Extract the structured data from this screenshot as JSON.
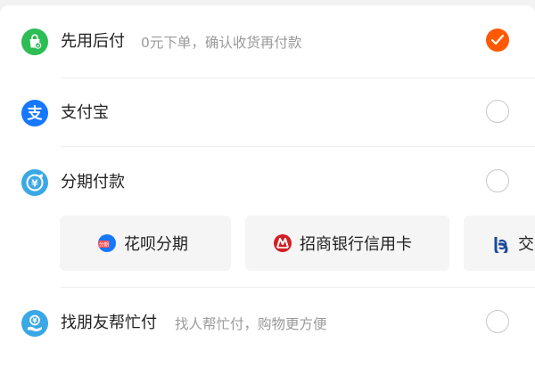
{
  "payment_methods": {
    "pay_later": {
      "title": "先用后付",
      "description": "0元下单，确认收货再付款",
      "icon": "pay-later-bag-icon",
      "selected": true
    },
    "alipay": {
      "title": "支付宝",
      "icon": "alipay-icon",
      "selected": false
    },
    "installment": {
      "title": "分期付款",
      "icon": "installment-icon",
      "selected": false,
      "options": [
        {
          "label": "花呗分期",
          "icon": "huabei-icon"
        },
        {
          "label": "招商银行信用卡",
          "icon": "cmb-icon"
        },
        {
          "label": "交",
          "icon": "bocom-icon"
        }
      ]
    },
    "friend_pay": {
      "title": "找朋友帮忙付",
      "description": "找人帮忙付，购物更方便",
      "icon": "friend-pay-icon",
      "selected": false
    }
  },
  "colors": {
    "accent": "#ff5a00",
    "alipay_blue": "#1677ff",
    "green": "#2cbd54",
    "installment_blue": "#3aa8e6",
    "text_primary": "#222222",
    "text_secondary": "#9a9a9a"
  }
}
